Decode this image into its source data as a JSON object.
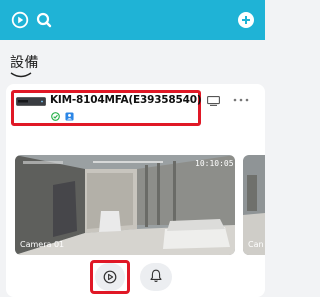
{
  "header": {
    "left_icons": [
      "play-circle-icon",
      "search-icon"
    ],
    "right_icon": "add-circle-icon",
    "color": "#1fb3d6"
  },
  "page": {
    "title": "設備"
  },
  "device": {
    "name": "KIM-8104MFA(E39358540)",
    "status_icons": [
      "online-check-icon",
      "shared-user-icon"
    ],
    "actions": [
      "monitor-icon",
      "more-icon"
    ]
  },
  "camera": {
    "timestamp": "10:10:05",
    "name": "Camera 01",
    "next_name": "Can"
  },
  "controls": {
    "buttons": [
      "play-button",
      "alarm-bell-button"
    ]
  },
  "colors": {
    "highlight": "#e01826",
    "online": "#2bb24c",
    "shared": "#2b86e6"
  }
}
